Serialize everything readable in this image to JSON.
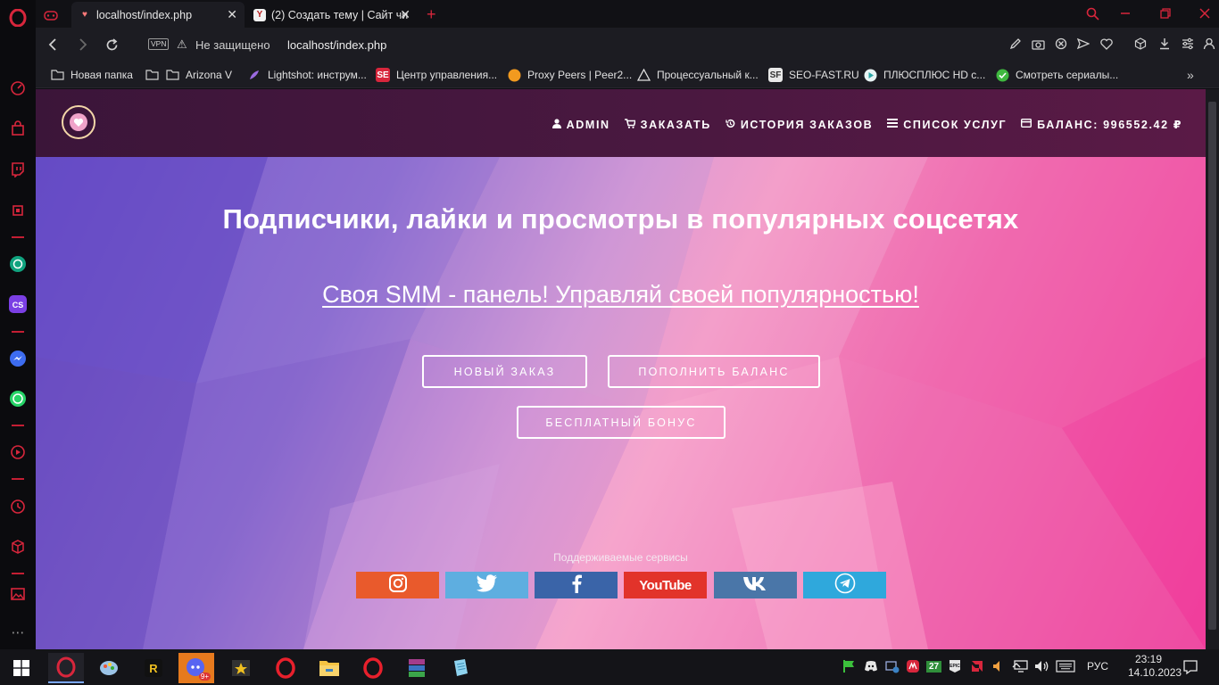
{
  "browser": {
    "tabs": [
      {
        "title": "localhost/index.php",
        "active": true
      },
      {
        "title": "(2) Создать тему | Сайт чи",
        "active": false
      }
    ],
    "address": {
      "vpn_label": "VPN",
      "security_text": "Не защищено",
      "url": "localhost/index.php"
    },
    "bookmarks": [
      {
        "label": "Новая папка",
        "icon": "folder-icon"
      },
      {
        "label": "Arizona V",
        "icon": "folder-icon"
      },
      {
        "label": "Lightshot: инструм...",
        "icon": "feather-icon"
      },
      {
        "label": "Центр управления...",
        "icon": "se-icon"
      },
      {
        "label": "Proxy Peers | Peer2...",
        "icon": "orange-circle-icon"
      },
      {
        "label": "Процессуальный к...",
        "icon": "triangle-icon"
      },
      {
        "label": "SEO-FAST.RU",
        "icon": "sf-icon"
      },
      {
        "label": "ПЛЮСПЛЮС HD с...",
        "icon": "play-icon"
      },
      {
        "label": "Смотреть сериалы...",
        "icon": "check-icon"
      }
    ]
  },
  "site": {
    "menu": [
      {
        "label": "ADMIN",
        "icon": "user-icon"
      },
      {
        "label": "ЗАКАЗАТЬ",
        "icon": "cart-icon"
      },
      {
        "label": "ИСТОРИЯ ЗАКАЗОВ",
        "icon": "history-icon"
      },
      {
        "label": "СПИСОК УСЛУГ",
        "icon": "list-icon"
      },
      {
        "label": "БАЛАНС: 996552.42 ₽",
        "icon": "wallet-icon"
      }
    ],
    "hero_title": "Подписчики, лайки и просмотры в популярных соцсетях",
    "hero_subtitle": "Своя SMM - панель! Управляй своей популярностью!",
    "buttons": {
      "new_order": "НОВЫЙ ЗАКАЗ",
      "top_up": "ПОПОЛНИТЬ БАЛАНС",
      "free_bonus": "БЕСПЛАТНЫЙ БОНУС"
    },
    "services_label": "Поддерживаемые сервисы",
    "services": [
      {
        "name": "instagram",
        "color": "#e95a2c"
      },
      {
        "name": "twitter",
        "color": "#5eaee0"
      },
      {
        "name": "facebook",
        "color": "#3a64a8"
      },
      {
        "name": "youtube",
        "color": "#e2332a"
      },
      {
        "name": "vk",
        "color": "#4a76a8"
      },
      {
        "name": "telegram",
        "color": "#2fa8dc"
      }
    ],
    "youtube_text": "YouTube"
  },
  "taskbar": {
    "lang": "РУС",
    "time": "23:19",
    "date": "14.10.2023",
    "badge": "27",
    "discord_badge": "9+"
  },
  "colors": {
    "opera_red": "#d8263c",
    "header_bg": "#4a1840"
  }
}
